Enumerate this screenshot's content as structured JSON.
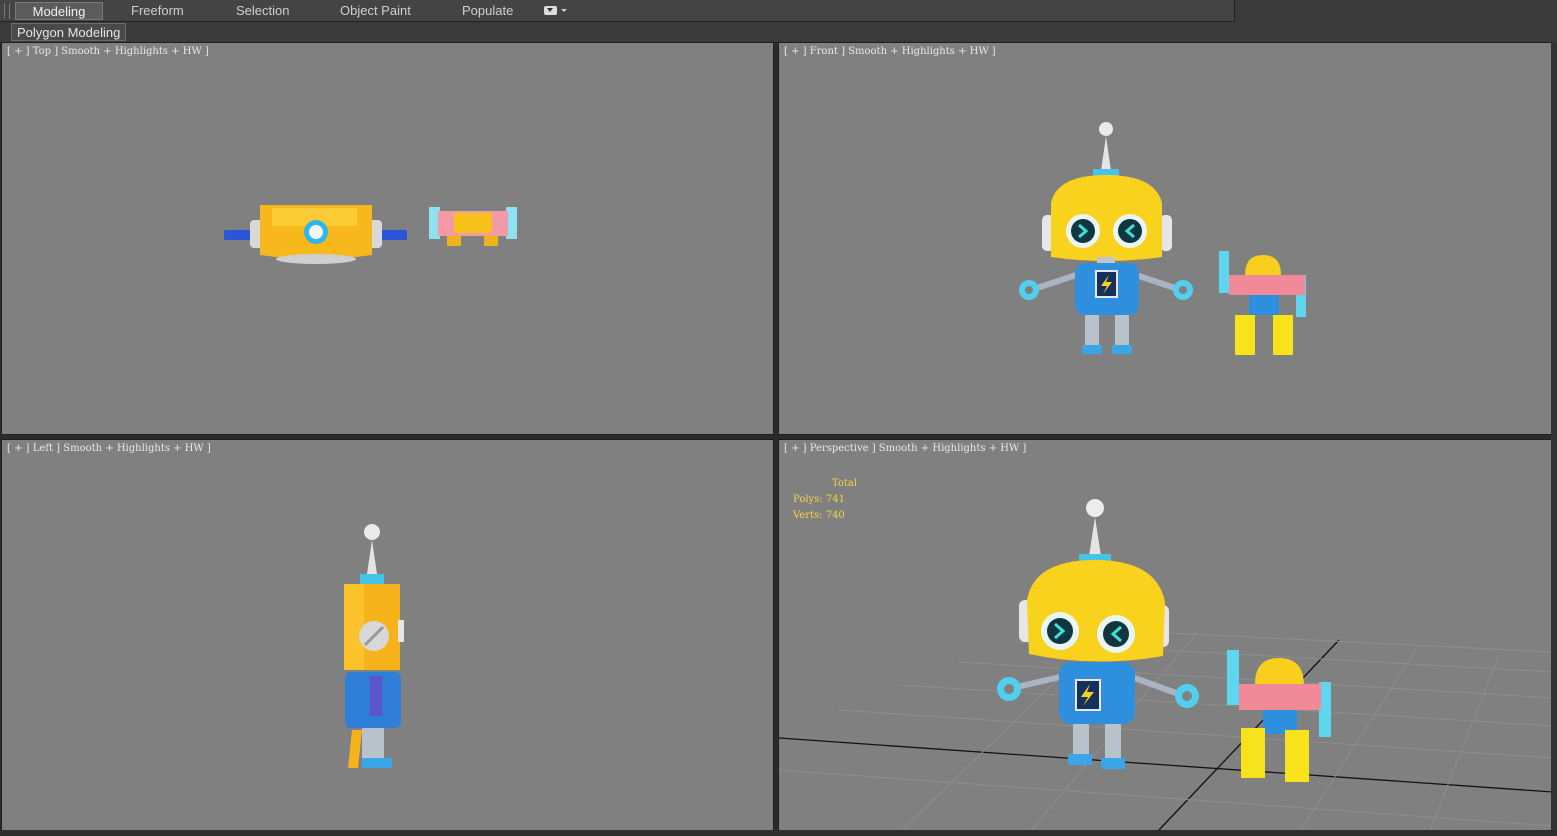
{
  "ribbon": {
    "tabs": [
      {
        "label": "Modeling",
        "active": true
      },
      {
        "label": "Freeform",
        "active": false
      },
      {
        "label": "Selection",
        "active": false
      },
      {
        "label": "Object Paint",
        "active": false
      },
      {
        "label": "Populate",
        "active": false
      }
    ],
    "options_icon": "panel-options-dropdown-icon"
  },
  "subbar": {
    "label": "Polygon Modeling"
  },
  "viewports": {
    "top": {
      "label": "[ + ] Top ] Smooth + Highlights + HW ]"
    },
    "front": {
      "label": "[ + ] Front ] Smooth + Highlights + HW ]"
    },
    "left": {
      "label": "[ + ] Left ] Smooth + Highlights + HW ]"
    },
    "perspective": {
      "label": "[ + ] Perspective ] Smooth + Highlights + HW ]",
      "stats": {
        "total": "Total",
        "polys": "Polys: 741",
        "verts": "Verts: 740"
      }
    }
  },
  "colors": {
    "viewport_bg": "#808080",
    "robot_yellow": "#f7cf1c",
    "robot_blue": "#2f8fdf",
    "robot_cyan": "#5fd6ef",
    "robot_pink": "#f08a98",
    "stats_text": "#f5d24a"
  }
}
